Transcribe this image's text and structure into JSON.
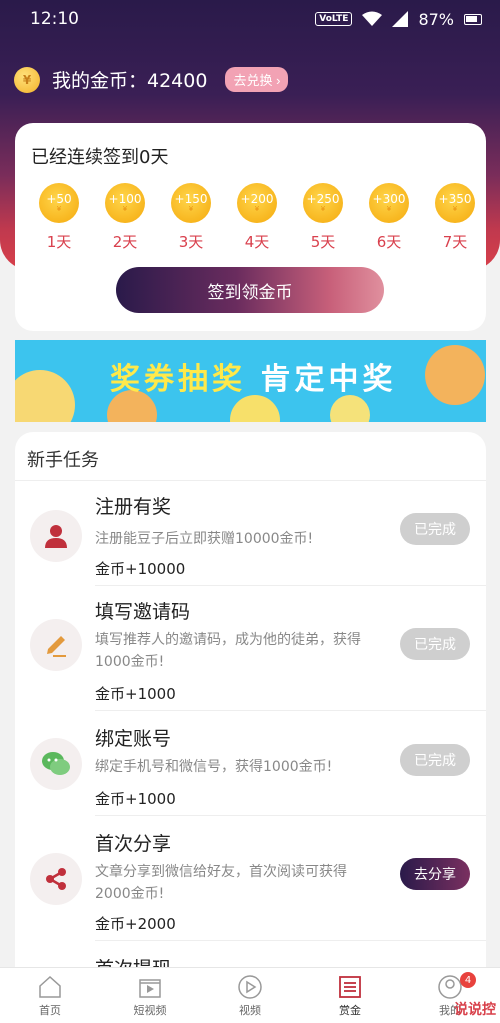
{
  "status_bar": {
    "time": "12:10",
    "network": "VoLTE",
    "battery": "87%"
  },
  "header": {
    "coin_label": "我的金币：42400",
    "exchange_button": "去兑换 ›",
    "coin_symbol": "¥"
  },
  "signin": {
    "title": "已经连续签到0天",
    "days": [
      {
        "reward": "+50",
        "label": "1天"
      },
      {
        "reward": "+100",
        "label": "2天"
      },
      {
        "reward": "+150",
        "label": "3天"
      },
      {
        "reward": "+200",
        "label": "4天"
      },
      {
        "reward": "+250",
        "label": "5天"
      },
      {
        "reward": "+300",
        "label": "6天"
      },
      {
        "reward": "+350",
        "label": "7天"
      }
    ],
    "button": "签到领金币"
  },
  "banner": {
    "text_a": "奖券抽奖",
    "text_b": "肯定中奖"
  },
  "tasks": {
    "header": "新手任务",
    "items": [
      {
        "title": "注册有奖",
        "desc": "注册能豆子后立即获赠10000金币!",
        "reward": "金币+10000",
        "button": "已完成",
        "icon": "user-icon"
      },
      {
        "title": "填写邀请码",
        "desc": "填写推荐人的邀请码，成为他的徒弟，获得1000金币!",
        "reward": "金币+1000",
        "button": "已完成",
        "icon": "pencil-icon"
      },
      {
        "title": "绑定账号",
        "desc": "绑定手机号和微信号，获得1000金币!",
        "reward": "金币+1000",
        "button": "已完成",
        "icon": "wechat-icon"
      },
      {
        "title": "首次分享",
        "desc": "文章分享到微信给好友，首次阅读可获得2000金币!",
        "reward": "金币+2000",
        "button": "去分享",
        "icon": "share-icon"
      },
      {
        "title": "首次提现"
      }
    ]
  },
  "nav": {
    "items": [
      {
        "label": "首页",
        "icon": "home-icon"
      },
      {
        "label": "短视频",
        "icon": "clapper-icon"
      },
      {
        "label": "视频",
        "icon": "play-icon"
      },
      {
        "label": "赏金",
        "icon": "list-icon"
      },
      {
        "label": "我的",
        "icon": "profile-icon",
        "badge": "4"
      }
    ]
  },
  "watermark": "说说控",
  "colors": {
    "accent": "#d9404d",
    "header_dark": "#2a1a4a",
    "coin_gold": "#f7b41c"
  }
}
